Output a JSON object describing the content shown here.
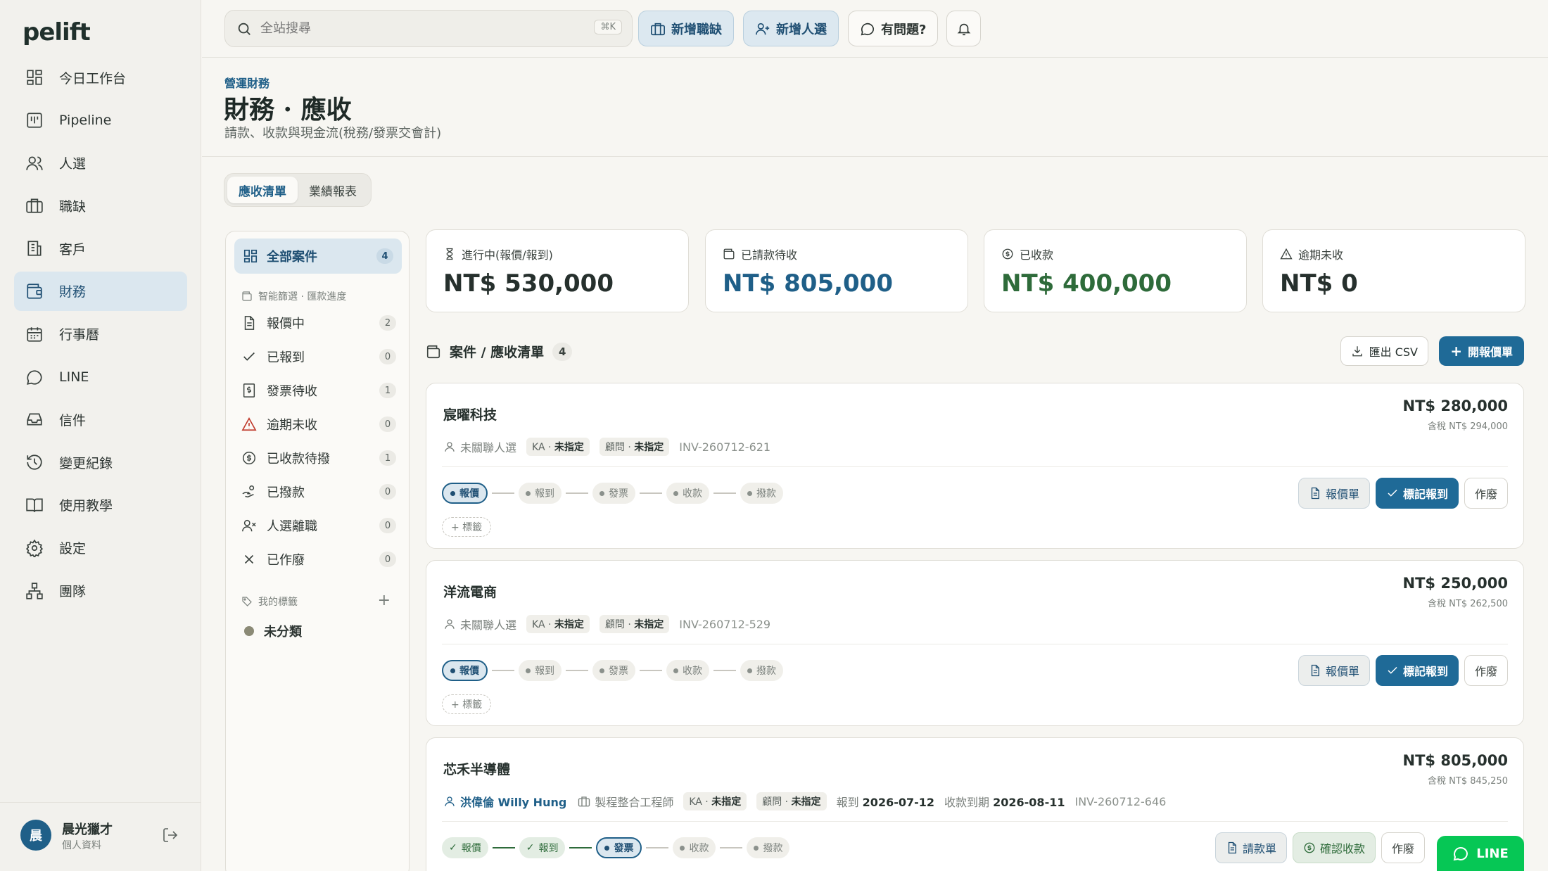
{
  "brand": {
    "logo": "pelift",
    "accent": "#1f5f88"
  },
  "sidebar": {
    "items": [
      {
        "label": "今日工作台",
        "icon": "dashboard-icon"
      },
      {
        "label": "Pipeline",
        "icon": "pipeline-icon"
      },
      {
        "label": "人選",
        "icon": "users-icon"
      },
      {
        "label": "職缺",
        "icon": "briefcase-icon"
      },
      {
        "label": "客戶",
        "icon": "building-icon"
      },
      {
        "label": "財務",
        "icon": "wallet-icon",
        "active": true
      },
      {
        "label": "行事曆",
        "icon": "calendar-icon"
      },
      {
        "label": "LINE",
        "icon": "chat-icon"
      },
      {
        "label": "信件",
        "icon": "inbox-icon"
      },
      {
        "label": "變更紀錄",
        "icon": "history-icon"
      },
      {
        "label": "使用教學",
        "icon": "book-icon"
      },
      {
        "label": "設定",
        "icon": "gear-icon"
      },
      {
        "label": "團隊",
        "icon": "team-icon"
      }
    ],
    "user": {
      "avatar": "晨",
      "name": "晨光獵才",
      "sub": "個人資料"
    }
  },
  "topbar": {
    "search_placeholder": "全站搜尋",
    "shortcut": "⌘K",
    "new_job": "新增職缺",
    "new_candidate": "新增人選",
    "help": "有問題?"
  },
  "header": {
    "crumb": "營運財務",
    "title": "財務 · 應收",
    "subtitle": "請款、收款與現金流(稅務/發票交會計)"
  },
  "tabs": [
    "應收清單",
    "業績報表"
  ],
  "filters": {
    "all": {
      "label": "全部案件",
      "count": "4"
    },
    "section": "智能篩選 · 匯款進度",
    "items": [
      {
        "label": "報價中",
        "count": "2"
      },
      {
        "label": "已報到",
        "count": "0"
      },
      {
        "label": "發票待收",
        "count": "1"
      },
      {
        "label": "逾期未收",
        "count": "0"
      },
      {
        "label": "已收款待撥",
        "count": "1"
      },
      {
        "label": "已撥款",
        "count": "0"
      },
      {
        "label": "人選離職",
        "count": "0"
      },
      {
        "label": "已作廢",
        "count": "0"
      }
    ],
    "tags_section": "我的標籤",
    "tags": [
      "未分類"
    ]
  },
  "kpis": [
    {
      "label": "進行中(報價/報到)",
      "value": "NT$ 530,000",
      "color": "#1f2a27"
    },
    {
      "label": "已請款待收",
      "value": "NT$ 805,000",
      "color": "#1f5f88"
    },
    {
      "label": "已收款",
      "value": "NT$ 400,000",
      "color": "#2e6b3a"
    },
    {
      "label": "逾期未收",
      "value": "NT$ 0",
      "color": "#1f2a27"
    }
  ],
  "list": {
    "title": "案件 / 應收清單",
    "count": "4",
    "export": "匯出 CSV",
    "new_quote": "開報價單"
  },
  "steps": [
    "報價",
    "報到",
    "發票",
    "收款",
    "撥款"
  ],
  "cards": [
    {
      "client": "宸曜科技",
      "amount": "NT$ 280,000",
      "tax": "含稅 NT$ 294,000",
      "candidate": "未關聯人選",
      "ka_label": "KA",
      "ka": "未指定",
      "adv_label": "顧問",
      "adv": "未指定",
      "invoice": "INV-260712-621",
      "tag_btn": "+ 標籤",
      "actions": [
        "報價單",
        "標記報到",
        "作廢"
      ]
    },
    {
      "client": "洋流電商",
      "amount": "NT$ 250,000",
      "tax": "含稅 NT$ 262,500",
      "candidate": "未關聯人選",
      "ka_label": "KA",
      "ka": "未指定",
      "adv_label": "顧問",
      "adv": "未指定",
      "invoice": "INV-260712-529",
      "tag_btn": "+ 標籤",
      "actions": [
        "報價單",
        "標記報到",
        "作廢"
      ]
    },
    {
      "client": "芯禾半導體",
      "amount": "NT$ 805,000",
      "tax": "含稅 NT$ 845,250",
      "candidate": "洪偉倫 Willy Hung",
      "job": "製程整合工程師",
      "ka_label": "KA",
      "ka": "未指定",
      "adv_label": "顧問",
      "adv": "未指定",
      "report_label": "報到",
      "report_date": "2026-07-12",
      "due_label": "收款到期",
      "due_date": "2026-08-11",
      "invoice": "INV-260712-646",
      "actions": [
        "請款單",
        "確認收款",
        "作廢"
      ]
    }
  ],
  "fab": "LINE"
}
